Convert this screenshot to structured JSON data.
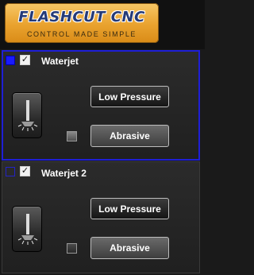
{
  "header": {
    "logo_title": "FLASHCUT CNC",
    "logo_subtitle": "CONTROL MADE SIMPLE"
  },
  "panels": [
    {
      "title": "Waterjet",
      "selected": true,
      "enabled": true,
      "color": "#1a1aff",
      "check_glyph": "✓",
      "low_pressure_label": "Low Pressure",
      "abrasive_label": "Abrasive"
    },
    {
      "title": "Waterjet 2",
      "selected": false,
      "enabled": true,
      "color": "#2323c8",
      "check_glyph": "✓",
      "low_pressure_label": "Low Pressure",
      "abrasive_label": "Abrasive"
    }
  ],
  "icons": {
    "switch": "toggle-switch-icon"
  }
}
